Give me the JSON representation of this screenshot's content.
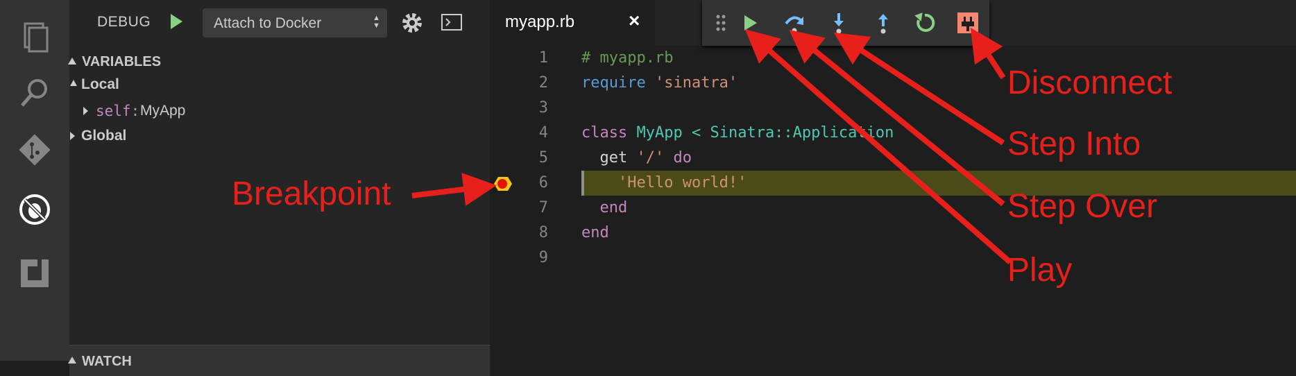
{
  "activity": {
    "icons": [
      "explorer-icon",
      "search-icon",
      "git-icon",
      "debug-icon",
      "extensions-icon"
    ]
  },
  "debug": {
    "label": "DEBUG",
    "config": "Attach to Docker"
  },
  "variables": {
    "header": "VARIABLES",
    "local_label": "Local",
    "self_name": "self:",
    "self_value": "MyApp",
    "global_label": "Global"
  },
  "watch": {
    "header": "WATCH"
  },
  "editor": {
    "tab_name": "myapp.rb",
    "tab_close": "×",
    "lines": [
      {
        "n": "1"
      },
      {
        "n": "2"
      },
      {
        "n": "3"
      },
      {
        "n": "4"
      },
      {
        "n": "5"
      },
      {
        "n": "6"
      },
      {
        "n": "7"
      },
      {
        "n": "8"
      },
      {
        "n": "9"
      }
    ],
    "code": {
      "l1": "# myapp.rb",
      "l2_kw": "require",
      "l2_str": "'sinatra'",
      "l4_kw": "class",
      "l4_name": "MyApp",
      "l4_op": "<",
      "l4_base": "Sinatra::Application",
      "l5_get": "get",
      "l5_str": "'/'",
      "l5_do": "do",
      "l6_str": "'Hello world!'",
      "l7": "end",
      "l8": "end"
    }
  },
  "annotations": {
    "breakpoint": "Breakpoint",
    "disconnect": "Disconnect",
    "step_into": "Step Into",
    "step_over": "Step Over",
    "play": "Play"
  },
  "colors": {
    "annotation": "#e8201c",
    "breakpoint": "#f5c518"
  }
}
